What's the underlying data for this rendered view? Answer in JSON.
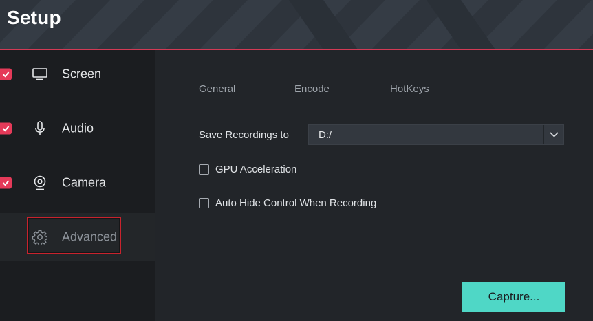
{
  "header": {
    "title": "Setup"
  },
  "sidebar": {
    "items": [
      {
        "label": "Screen",
        "checked": true,
        "icon": "monitor-icon"
      },
      {
        "label": "Audio",
        "checked": true,
        "icon": "microphone-icon"
      },
      {
        "label": "Camera",
        "checked": true,
        "icon": "webcam-icon"
      },
      {
        "label": "Advanced",
        "checked": false,
        "selected": true,
        "icon": "gear-icon"
      }
    ]
  },
  "main": {
    "tabs": [
      {
        "label": "General"
      },
      {
        "label": "Encode"
      },
      {
        "label": "HotKeys"
      }
    ],
    "save_recordings": {
      "label": "Save Recordings to",
      "value": "D:/"
    },
    "options": [
      {
        "label": "GPU Acceleration",
        "checked": false
      },
      {
        "label": "Auto Hide Control When Recording",
        "checked": false
      }
    ],
    "capture_button": "Capture..."
  },
  "colors": {
    "accent": "#e53a59",
    "capture": "#4fd7c6",
    "highlight_border": "#c8232d"
  }
}
